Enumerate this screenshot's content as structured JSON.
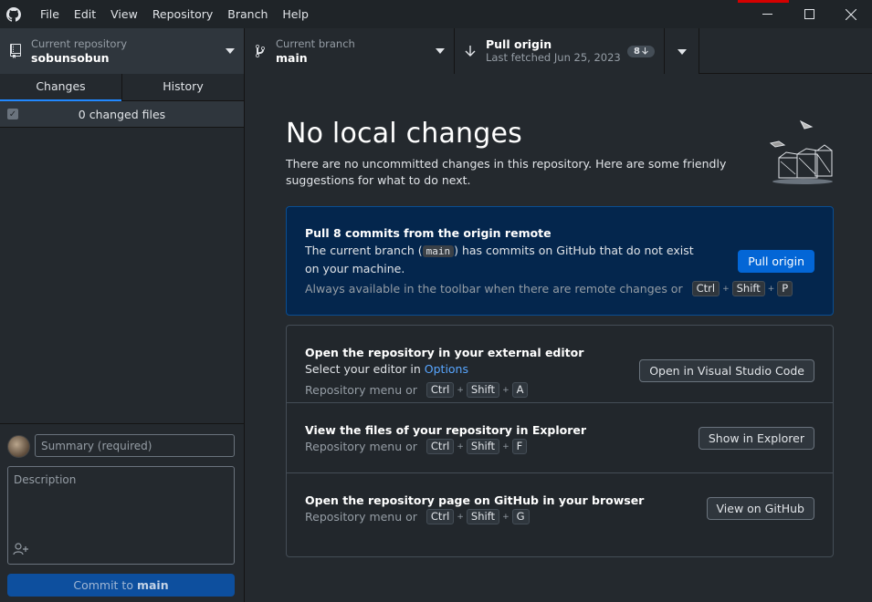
{
  "menu": [
    "File",
    "Edit",
    "View",
    "Repository",
    "Branch",
    "Help"
  ],
  "window_controls": {
    "minimize": "—",
    "maximize": "☐",
    "close": "✕"
  },
  "toolbar": {
    "repo": {
      "caption": "Current repository",
      "value": "sobunsobun"
    },
    "branch": {
      "caption": "Current branch",
      "value": "main"
    },
    "pull": {
      "title": "Pull origin",
      "subtitle": "Last fetched Jun 25, 2023",
      "badge": "8"
    }
  },
  "sidebar": {
    "tabs": [
      "Changes",
      "History"
    ],
    "changed_files": "0 changed files",
    "summary_placeholder": "Summary (required)",
    "description_placeholder": "Description",
    "commit_prefix": "Commit to",
    "commit_branch": "main"
  },
  "main": {
    "heading": "No local changes",
    "subtext": "There are no uncommitted changes in this repository. Here are some friendly suggestions for what to do next.",
    "pull_card": {
      "title": "Pull 8 commits from the origin remote",
      "text_before": "The current branch (",
      "branch_code": "main",
      "text_after": ") has commits on GitHub that do not exist on your machine.",
      "hint": "Always available in the toolbar when there are remote changes or",
      "keys": [
        "Ctrl",
        "Shift",
        "P"
      ],
      "button": "Pull origin"
    },
    "editor_card": {
      "title": "Open the repository in your external editor",
      "text": "Select your editor in",
      "link": "Options",
      "hint": "Repository menu or",
      "keys": [
        "Ctrl",
        "Shift",
        "A"
      ],
      "button": "Open in Visual Studio Code"
    },
    "explorer_card": {
      "title": "View the files of your repository in Explorer",
      "hint": "Repository menu or",
      "keys": [
        "Ctrl",
        "Shift",
        "F"
      ],
      "button": "Show in Explorer"
    },
    "github_card": {
      "title": "Open the repository page on GitHub in your browser",
      "hint": "Repository menu or",
      "keys": [
        "Ctrl",
        "Shift",
        "G"
      ],
      "button": "View on GitHub"
    }
  },
  "colors": {
    "accent": "#0366d6",
    "background": "#24292e",
    "tab_indicator": "#2188ff"
  }
}
